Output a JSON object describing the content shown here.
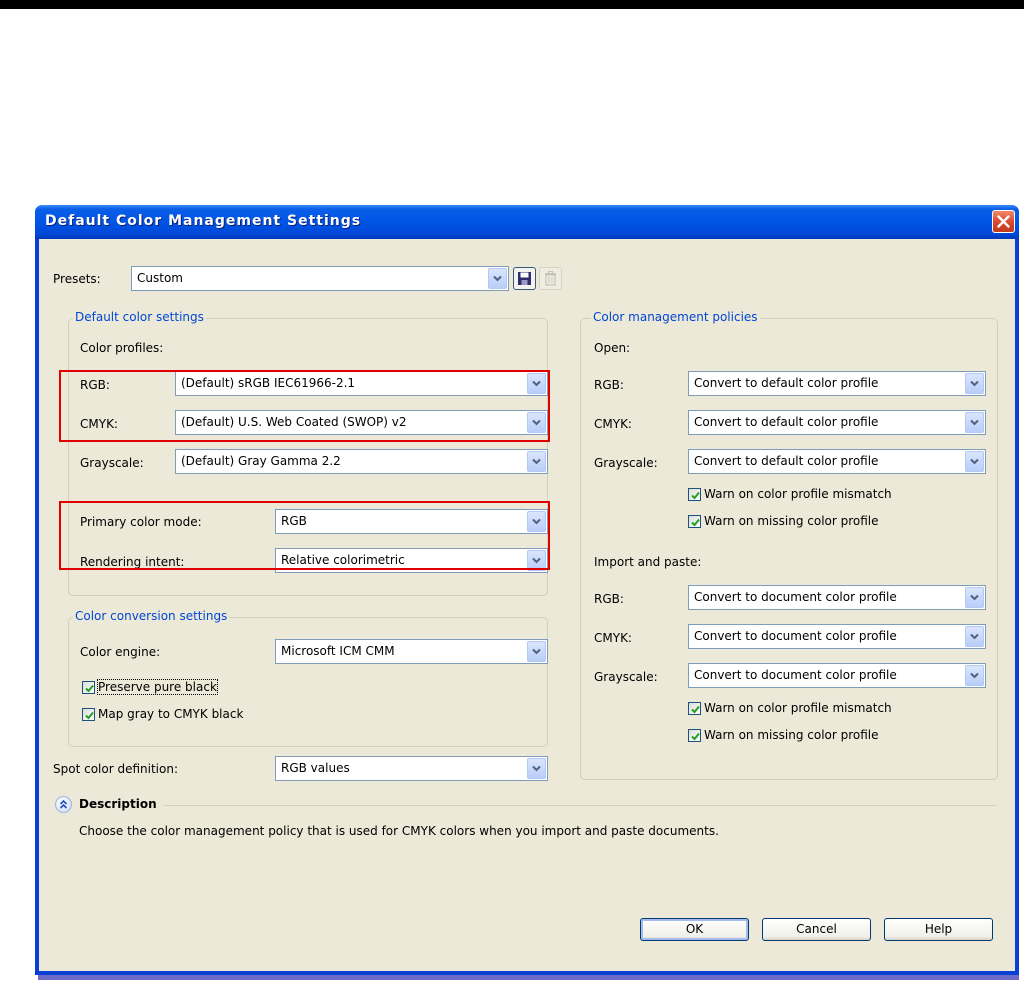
{
  "dialog": {
    "title": "Default Color Management Settings",
    "close_icon": "close-x-icon"
  },
  "presets": {
    "label": "Presets:",
    "value": "Custom",
    "save_icon": "floppy-disk-icon",
    "delete_icon": "trash-icon"
  },
  "default_color_settings": {
    "group_title": "Default color settings",
    "profiles_label": "Color profiles:",
    "rgb": {
      "label": "RGB:",
      "value": "(Default) sRGB IEC61966-2.1"
    },
    "cmyk": {
      "label": "CMYK:",
      "value": "(Default) U.S. Web Coated (SWOP) v2"
    },
    "grayscale": {
      "label": "Grayscale:",
      "value": "(Default) Gray Gamma 2.2"
    },
    "primary_mode": {
      "label": "Primary color mode:",
      "value": "RGB"
    },
    "rendering_intent": {
      "label": "Rendering intent:",
      "value": "Relative colorimetric"
    }
  },
  "color_conversion": {
    "group_title": "Color conversion settings",
    "engine": {
      "label": "Color engine:",
      "value": "Microsoft ICM CMM"
    },
    "preserve_black": {
      "label": "Preserve pure black",
      "checked": true
    },
    "map_gray": {
      "label": "Map gray to CMYK black",
      "checked": true
    }
  },
  "spot_color": {
    "label": "Spot color definition:",
    "value": "RGB values"
  },
  "policies": {
    "group_title": "Color management policies",
    "open": {
      "heading": "Open:",
      "rgb": {
        "label": "RGB:",
        "value": "Convert to default color profile"
      },
      "cmyk": {
        "label": "CMYK:",
        "value": "Convert to default color profile"
      },
      "grayscale": {
        "label": "Grayscale:",
        "value": "Convert to default color profile"
      },
      "warn_mismatch": {
        "label": "Warn on color profile mismatch",
        "checked": true
      },
      "warn_missing": {
        "label": "Warn on missing color profile",
        "checked": true
      }
    },
    "import": {
      "heading": "Import and paste:",
      "rgb": {
        "label": "RGB:",
        "value": "Convert to document color profile"
      },
      "cmyk": {
        "label": "CMYK:",
        "value": "Convert to document color profile"
      },
      "grayscale": {
        "label": "Grayscale:",
        "value": "Convert to document color profile"
      },
      "warn_mismatch": {
        "label": "Warn on color profile mismatch",
        "checked": true
      },
      "warn_missing": {
        "label": "Warn on missing color profile",
        "checked": true
      }
    }
  },
  "description": {
    "title": "Description",
    "text": "Choose the color management policy that is used for CMYK colors when you import and paste documents."
  },
  "buttons": {
    "ok": "OK",
    "cancel": "Cancel",
    "help": "Help"
  },
  "colors": {
    "titlebar": "#0055e5",
    "dialog_bg": "#ece9d8",
    "group_title": "#0046d5",
    "highlight": "#e00000",
    "check": "#21a121"
  }
}
